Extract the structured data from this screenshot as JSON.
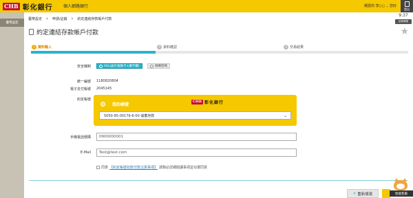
{
  "header": {
    "logo_badge": "CHB",
    "logo_text": "彰化銀行",
    "bank_section": "個人網路銀行",
    "user_greeting": "親愛的 李○○ ，您好",
    "exit_label": "登出"
  },
  "sidebar": {
    "items": [
      {
        "label": "臺幣設定"
      }
    ]
  },
  "breadcrumb": {
    "items": [
      "臺幣設定",
      "申請/註銷",
      "約定連結存款帳戶付款"
    ]
  },
  "session": {
    "time_left": "9:37",
    "extend_label": "延長時間"
  },
  "page": {
    "title": "約定連結存款帳戶付款"
  },
  "steps": [
    {
      "num": "1",
      "label": "資料輸入",
      "active": true
    },
    {
      "num": "2",
      "label": "資料確認",
      "active": false
    },
    {
      "num": "3",
      "label": "交易結果",
      "active": false
    }
  ],
  "progress": {
    "fraction": 0.33
  },
  "form": {
    "security_label": "安全機制",
    "security_options": [
      {
        "label": "SSL(晶片金融卡+讀卡機)",
        "selected": true
      },
      {
        "label": "隨機密碼",
        "selected": false
      }
    ],
    "unified_id_label": "統一編號",
    "unified_id_value": "1180820804",
    "epay_account_label": "電子支付帳號",
    "epay_account_value": "2045145",
    "bind_account_label": "約定帳號",
    "card_label": "我的帳號",
    "card_bank_badge": "CHB",
    "card_bank_name": "彰化銀行",
    "account_select_value": "5050-95-00179-6-00 儲蓄存款",
    "phone_label": "手機電話號碼",
    "phone_value": "0900000001",
    "email_label": "E-Mail",
    "email_value": "Test@test.com",
    "agree_prefix": "同意",
    "agree_link": "【約定帳號扣款付款注意事項】",
    "agree_suffix": "請務必詳細閱讀事項並勾選同意",
    "reset_label": "重新填寫",
    "helper_label": "智能客服"
  }
}
